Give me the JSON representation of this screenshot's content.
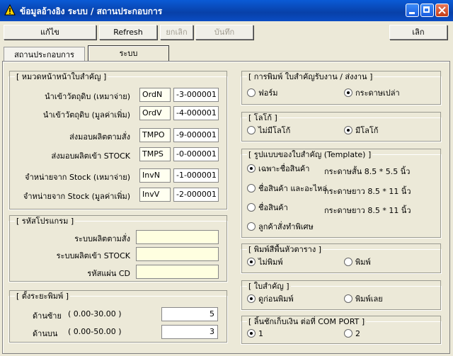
{
  "window": {
    "title": "ข้อมูลอ้างอิง ระบบ / สถานประกอบการ",
    "title_bar_color": "#0840a8"
  },
  "toolbar": {
    "edit_label": "แก้ไข",
    "refresh_label": "Refresh",
    "cancel_label": "ยกเลิก",
    "save_label": "บันทึก",
    "exit_label": "เลิก"
  },
  "tabs": [
    {
      "label": "สถานประกอบการ",
      "active": false
    },
    {
      "label": "ระบบ",
      "active": true
    }
  ],
  "doc_group": {
    "legend": "[ หมวดหน้าหน้าใบสำคัญ ]",
    "rows": [
      {
        "label": "นำเข้าวัตถุดิบ (เหมาจ่าย)",
        "code": "OrdN",
        "number": "-3-000001"
      },
      {
        "label": "นำเข้าวัตถุดิบ (มูลค่าเพิ่ม)",
        "code": "OrdV",
        "number": "-4-000001"
      },
      {
        "label": "ส่งมอบผลิตตามสั่ง",
        "code": "TMPO",
        "number": "-9-000001"
      },
      {
        "label": "ส่งมอบผลิตเข้า STOCK",
        "code": "TMPS",
        "number": "-0-000001"
      },
      {
        "label": "จำหน่ายจาก Stock (เหมาจ่าย)",
        "code": "InvN",
        "number": "-1-000001"
      },
      {
        "label": "จำหน่ายจาก Stock (มูลค่าเพิ่ม)",
        "code": "InvV",
        "number": "-2-000001"
      }
    ]
  },
  "program_group": {
    "legend": "[ รหัสโปรแกรม ]",
    "rows": [
      {
        "label": "ระบบผลิตตามสั่ง",
        "value": ""
      },
      {
        "label": "ระบบผลิตเข้า STOCK",
        "value": ""
      },
      {
        "label": "รหัสแผ่น CD",
        "value": ""
      }
    ]
  },
  "margin_group": {
    "legend": "[ ตั้งระยะพิมพ์ ]",
    "rows": [
      {
        "label": "ด้านซ้าย",
        "range": "( 0.00-30.00 )",
        "value": "5"
      },
      {
        "label": "ด้านบน",
        "range": "( 0.00-50.00 )",
        "value": "3"
      }
    ]
  },
  "print_group": {
    "legend": "[ การพิมพ์ ใบสำคัญรับงาน / ส่งงาน ]",
    "options": [
      {
        "label": "ฟอร์ม",
        "selected": false
      },
      {
        "label": "กระดาษเปล่า",
        "selected": true
      }
    ]
  },
  "logo_group": {
    "legend": "[ โลโก้ ]",
    "options": [
      {
        "label": "ไม่มีโลโก้",
        "selected": false
      },
      {
        "label": "มีโลโก้",
        "selected": true
      }
    ]
  },
  "template_group": {
    "legend": "[ รูปแบบของใบสำคัญ (Template) ]",
    "options": [
      {
        "label": "เฉพาะชื่อสินค้า",
        "paper": "กระดาษสั้น 8.5 * 5.5 นิ้ว",
        "selected": true
      },
      {
        "label": "ชื่อสินค้า และอะไหล่",
        "paper": "กระดาษยาว 8.5 * 11 นิ้ว",
        "selected": false
      },
      {
        "label": "ชื่อสินค้า",
        "paper": "กระดาษยาว 8.5 * 11 นิ้ว",
        "selected": false
      },
      {
        "label": "ลูกค้าสั่งทำพิเศษ",
        "paper": "",
        "selected": false
      }
    ]
  },
  "header_group": {
    "legend": "[ พิมพ์สีพื้นหัวตาราง ]",
    "options": [
      {
        "label": "ไม่พิมพ์",
        "selected": true
      },
      {
        "label": "พิมพ์",
        "selected": false
      }
    ]
  },
  "voucher_group": {
    "legend": "[ ใบสำคัญ ]",
    "options": [
      {
        "label": "ดูก่อนพิมพ์",
        "selected": true
      },
      {
        "label": "พิมพ์เลย",
        "selected": false
      }
    ]
  },
  "drawer_group": {
    "legend": "[ ลิ้นชักเก็บเงิน ต่อที่ COM PORT ]",
    "options": [
      {
        "label": "1",
        "selected": true
      },
      {
        "label": "2",
        "selected": false
      }
    ]
  }
}
